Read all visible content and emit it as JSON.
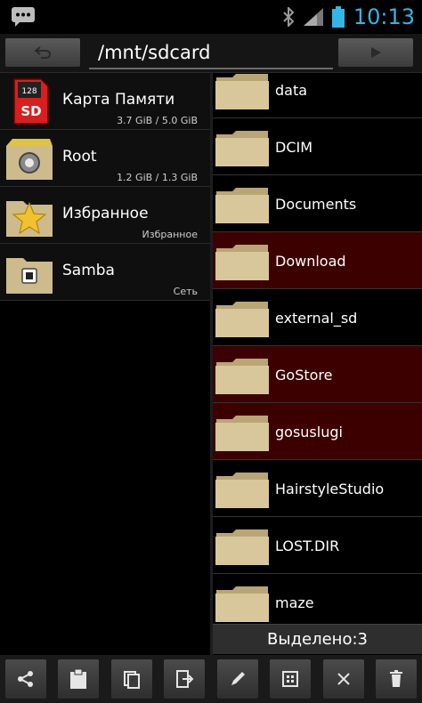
{
  "status_bar": {
    "time": "10:13",
    "icons": [
      "notification-icon",
      "bluetooth-icon",
      "signal-icon",
      "battery-icon"
    ]
  },
  "path_bar": {
    "path": "/mnt/sdcard"
  },
  "locations": [
    {
      "name": "Карта Памяти",
      "info": "3.7 GiB / 5.0 GiB",
      "icon": "sd-card-icon"
    },
    {
      "name": "Root",
      "info": "1.2 GiB / 1.3 GiB",
      "icon": "root-folder-icon"
    },
    {
      "name": "Избранное",
      "info": "Избранное",
      "icon": "favorites-folder-icon"
    },
    {
      "name": "Samba",
      "info": "Сеть",
      "icon": "network-folder-icon"
    }
  ],
  "files": [
    {
      "name": "data",
      "selected": false
    },
    {
      "name": "DCIM",
      "selected": false
    },
    {
      "name": "Documents",
      "selected": false
    },
    {
      "name": "Download",
      "selected": true
    },
    {
      "name": "external_sd",
      "selected": false
    },
    {
      "name": "GoStore",
      "selected": true
    },
    {
      "name": "gosuslugi",
      "selected": true
    },
    {
      "name": "HairstyleStudio",
      "selected": false
    },
    {
      "name": "LOST.DIR",
      "selected": false
    },
    {
      "name": "maze",
      "selected": false
    }
  ],
  "selection": {
    "label": "Выделено:3"
  },
  "toolbar": [
    "share-icon",
    "clipboard-icon",
    "copy-icon",
    "move-icon",
    "rename-icon",
    "select-all-icon",
    "deselect-icon",
    "delete-icon"
  ],
  "colors": {
    "accent": "#33b5e5",
    "selected_row": "#3d0000",
    "folder": "#d8c79a"
  }
}
